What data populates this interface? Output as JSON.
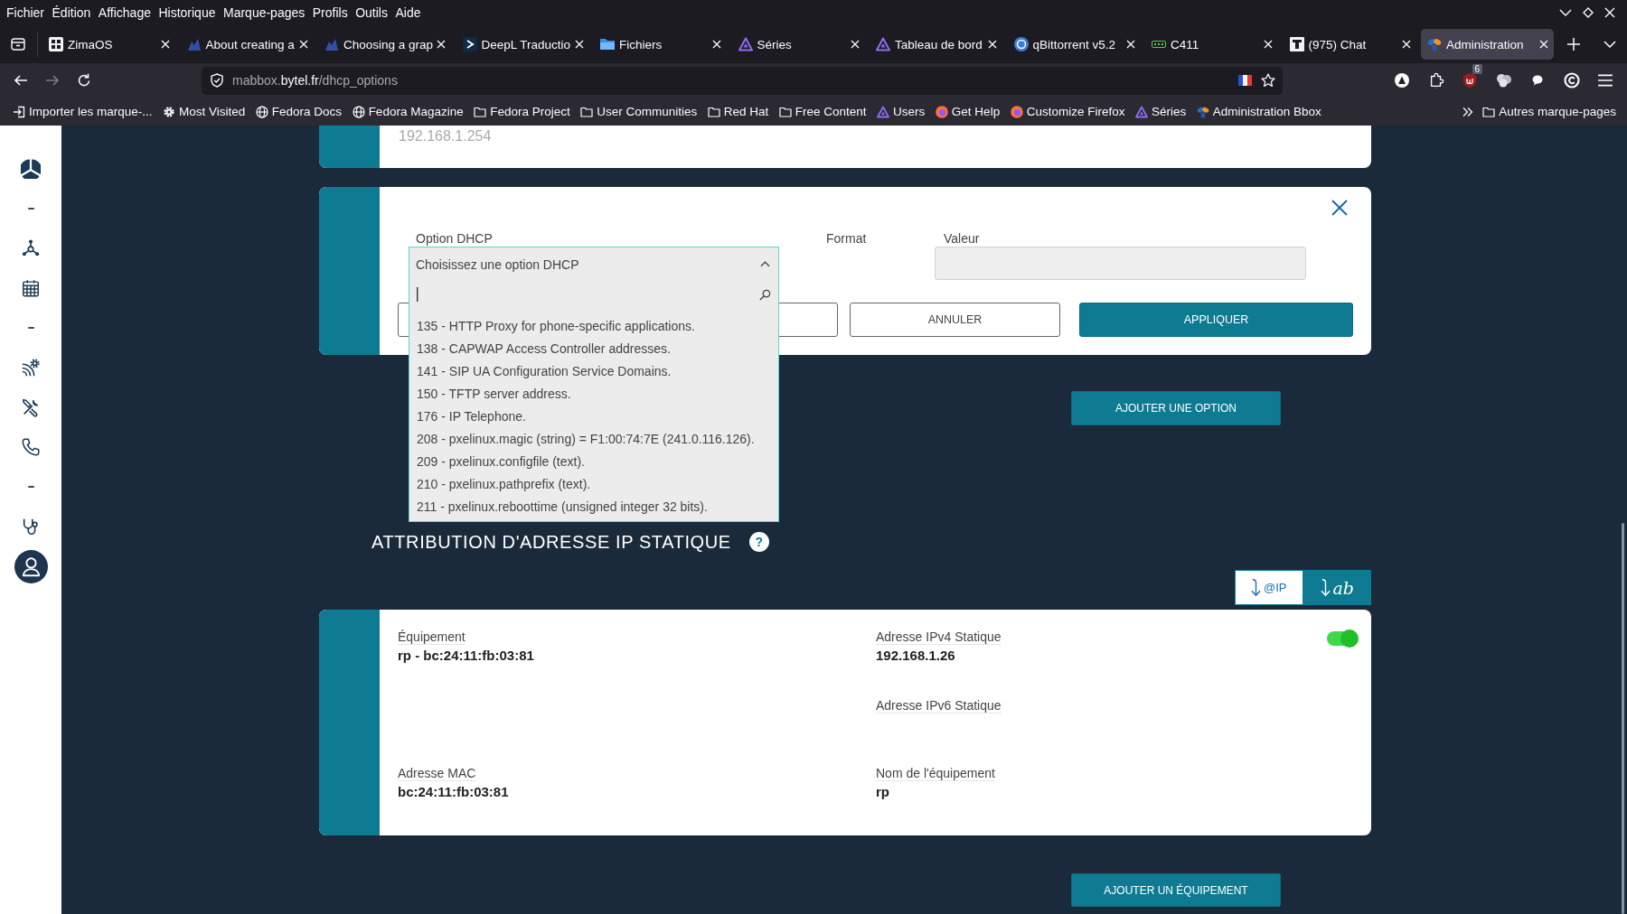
{
  "menu_bar": {
    "items": [
      "Fichier",
      "Édition",
      "Affichage",
      "Historique",
      "Marque-pages",
      "Profils",
      "Outils",
      "Aide"
    ]
  },
  "tabs": [
    {
      "title": "ZimaOS",
      "kind": "grid",
      "selected": false
    },
    {
      "title": "About creating a",
      "kind": "figure",
      "selected": false
    },
    {
      "title": "Choosing a grap",
      "kind": "figure",
      "selected": false
    },
    {
      "title": "DeepL Traductio",
      "kind": "chevron",
      "selected": false
    },
    {
      "title": "Fichiers",
      "kind": "folder",
      "selected": false
    },
    {
      "title": "Séries",
      "kind": "triangle",
      "selected": false
    },
    {
      "title": "Tableau de bord",
      "kind": "triangle",
      "selected": false
    },
    {
      "title": "qBittorrent v5.2",
      "kind": "disc",
      "selected": false
    },
    {
      "title": "C411",
      "kind": "tag",
      "selected": false
    },
    {
      "title": "(975) Chat",
      "kind": "square",
      "selected": false
    },
    {
      "title": "Administration",
      "kind": "petals",
      "selected": true
    }
  ],
  "address_bar": {
    "url": {
      "subdomain": "mabbox.",
      "domain": "bytel.fr",
      "path": "/dhcp_options"
    }
  },
  "toolbar": {
    "extension_badge": "6"
  },
  "bookmarks": {
    "items": [
      {
        "label": "Importer les marque-...",
        "kind": "import"
      },
      {
        "label": "Most Visited",
        "kind": "gear"
      },
      {
        "label": "Fedora Docs",
        "kind": "globe"
      },
      {
        "label": "Fedora Magazine",
        "kind": "globe"
      },
      {
        "label": "Fedora Project",
        "kind": "folder"
      },
      {
        "label": "User Communities",
        "kind": "folder"
      },
      {
        "label": "Red Hat",
        "kind": "folder"
      },
      {
        "label": "Free Content",
        "kind": "folder"
      },
      {
        "label": "Users",
        "kind": "triangle"
      },
      {
        "label": "Get Help",
        "kind": "fox"
      },
      {
        "label": "Customize Firefox",
        "kind": "fox"
      },
      {
        "label": "Séries",
        "kind": "triangle"
      },
      {
        "label": "Administration Bbox",
        "kind": "petals"
      }
    ],
    "other": "Autres marque-pages"
  },
  "page": {
    "previous_card": {
      "value": "192.168.1.254"
    },
    "dhcp_form": {
      "option_label": "Option DHCP",
      "dropdown": {
        "placeholder": "Choisissez une option DHCP",
        "expanded": true,
        "options": [
          "135 - HTTP Proxy for phone-specific applications.",
          "138 - CAPWAP Access Controller addresses.",
          "141 - SIP UA Configuration Service Domains.",
          "150 - TFTP server address.",
          "176 - IP Telephone.",
          "208 - pxelinux.magic (string) = F1:00:74:7E (241.0.116.126).",
          "209 - pxelinux.configfile (text).",
          "210 - pxelinux.pathprefix (text).",
          "211 - pxelinux.reboottime (unsigned integer 32 bits)."
        ]
      },
      "format_label": "Format",
      "value_label": "Valeur",
      "buttons": [
        {
          "kind": "outline"
        },
        {
          "label": "ANNULER",
          "kind": "outline"
        },
        {
          "label": "APPLIQUER",
          "kind": "primary"
        }
      ]
    },
    "add_option_button": "AJOUTER UNE OPTION",
    "static_ip": {
      "title": "ATTRIBUTION D'ADRESSE IP STATIQUE",
      "help": "?",
      "sort_buttons": [
        {
          "label": "@IP",
          "kind": "address",
          "selected": false
        },
        {
          "label": "ab",
          "kind": "alphabetic",
          "selected": true
        }
      ],
      "devices": [
        {
          "enabled": true,
          "fields": [
            {
              "label": "Équipement",
              "value": "rp - bc:24:11:fb:03:81"
            },
            {
              "label": "Adresse IPv4 Statique",
              "value": "192.168.1.26"
            },
            {
              "label": "Adresse IPv6 Statique"
            },
            {
              "label": "Adresse MAC",
              "value": "bc:24:11:fb:03:81"
            },
            {
              "label": "Nom de l'équipement",
              "value": "rp"
            }
          ]
        }
      ],
      "add_button": "AJOUTER UN ÉQUIPEMENT"
    }
  }
}
